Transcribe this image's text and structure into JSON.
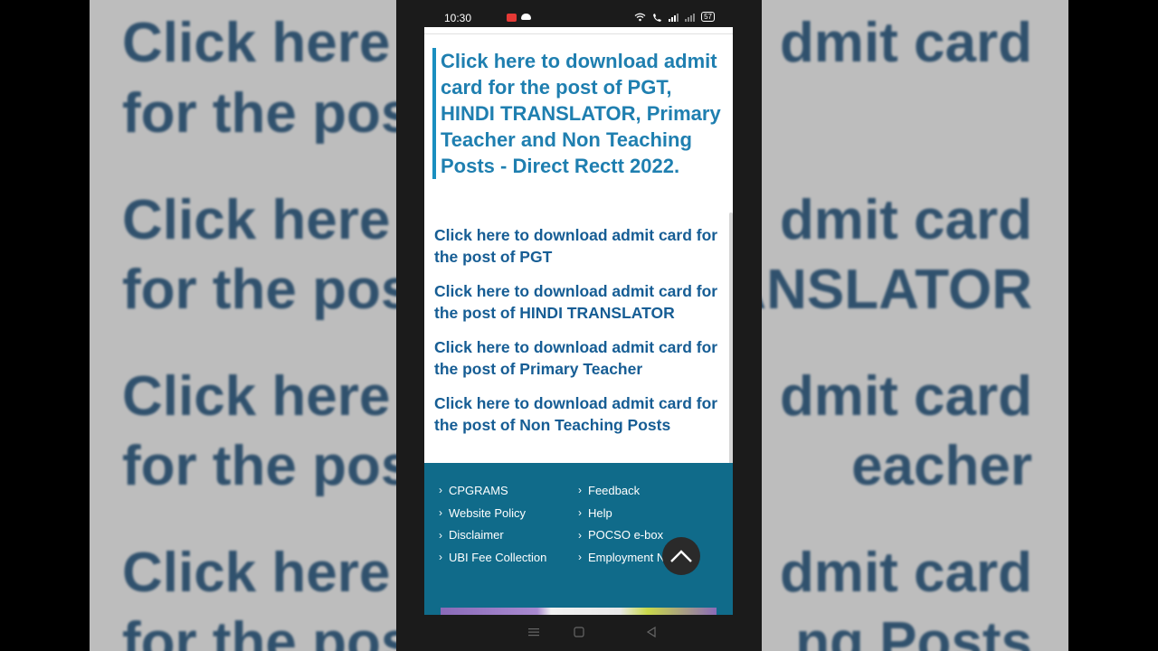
{
  "background": {
    "left_lines": [
      "Click here t",
      "for the pos",
      "Click here t",
      "for the pos",
      "Click here t",
      "for the pos",
      "Click here t",
      "for the pos"
    ],
    "right_lines": [
      "dmit card",
      "",
      "dmit card",
      "ANSLATOR",
      "dmit card",
      "eacher",
      "dmit card",
      "ng Posts"
    ]
  },
  "statusbar": {
    "time": "10:30",
    "battery": "57"
  },
  "heading": "Click here to download admit card for the post of PGT, HINDI TRANSLATOR, Primary Teacher and Non Teaching Posts - Direct Rectt 2022.",
  "links": [
    "Click here to download admit card for the post of PGT",
    "Click here to download admit card for the post of HINDI TRANSLATOR",
    "Click here to download admit card for the post of Primary Teacher",
    "Click here to download admit card for the post of Non Teaching Posts"
  ],
  "footer": {
    "col1": [
      "CPGRAMS",
      "Website Policy",
      "Disclaimer",
      "UBI Fee Collection"
    ],
    "col2": [
      "Feedback",
      "Help",
      "POCSO e-box",
      "Employment Notice"
    ]
  },
  "colors": {
    "heading": "#1f7fb0",
    "link": "#165d94",
    "footer_bg": "#106b8a"
  }
}
